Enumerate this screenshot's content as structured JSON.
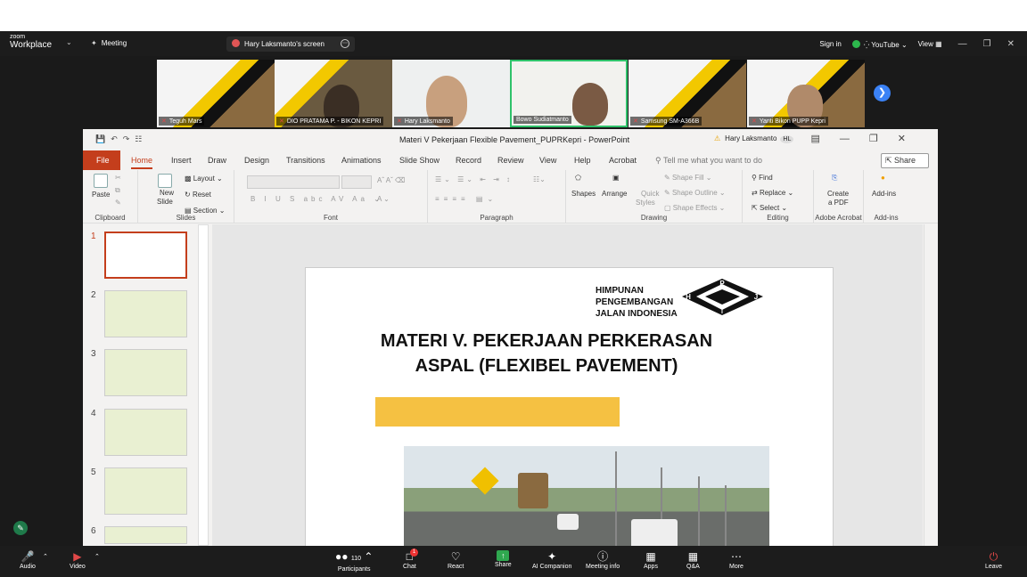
{
  "zoom": {
    "brand_small": "zoom",
    "brand_main": "Workplace",
    "meeting_label": "Meeting",
    "screen_share_label": "Hary Laksmanto's screen",
    "sign_in": "Sign in",
    "youtube": "YouTube",
    "view": "View",
    "participants_count": "110",
    "toolbar": {
      "audio": "Audio",
      "video": "Video",
      "participants": "Participants",
      "chat": "Chat",
      "chat_badge": "1",
      "react": "React",
      "share": "Share",
      "ai": "AI Companion",
      "info": "Meeting info",
      "apps": "Apps",
      "qa": "Q&A",
      "more": "More",
      "leave": "Leave"
    },
    "participants": [
      {
        "name": "Teguh Mars"
      },
      {
        "name": "DIO PRATAMA P. - BIKON KEPRI"
      },
      {
        "name": "Hary Laksmanto"
      },
      {
        "name": "Bowo Sudiatmanto"
      },
      {
        "name": "Samsung SM-A366B"
      },
      {
        "name": "Yanti Bikon PUPP Kepri"
      }
    ]
  },
  "ppt": {
    "title": "Materi V Pekerjaan Flexible Pavement_PUPRKepri  -  PowerPoint",
    "user": "Hary Laksmanto",
    "user_initials": "HL",
    "tabs": [
      "File",
      "Home",
      "Insert",
      "Draw",
      "Design",
      "Transitions",
      "Animations",
      "Slide Show",
      "Record",
      "Review",
      "View",
      "Help",
      "Acrobat"
    ],
    "tell_me": "Tell me what you want to do",
    "share": "Share",
    "ribbon": {
      "paste": "Paste",
      "clipboard": "Clipboard",
      "new_slide_1": "New",
      "new_slide_2": "Slide",
      "layout": "Layout",
      "reset": "Reset",
      "section": "Section",
      "slides": "Slides",
      "font": "Font",
      "paragraph": "Paragraph",
      "shapes": "Shapes",
      "arrange": "Arrange",
      "quick_styles_1": "Quick",
      "quick_styles_2": "Styles",
      "shape_fill": "Shape Fill",
      "shape_outline": "Shape Outline",
      "shape_effects": "Shape Effects",
      "drawing": "Drawing",
      "find": "Find",
      "replace": "Replace",
      "select": "Select",
      "editing": "Editing",
      "create_pdf_1": "Create",
      "create_pdf_2": "a PDF",
      "adobe": "Adobe Acrobat",
      "addins": "Add-ins",
      "addins_grp": "Add-ins"
    },
    "slide_numbers": [
      "1",
      "2",
      "3",
      "4",
      "5",
      "6"
    ],
    "slide": {
      "org_line1": "HIMPUNAN",
      "org_line2": "PENGEMBANGAN",
      "org_line3": "JALAN INDONESIA",
      "title_line1": "MATERI V. PEKERJAAN PERKERASAN",
      "title_line2": "ASPAL (FLEXIBEL PAVEMENT)",
      "logo_letters": [
        "P",
        "H",
        "J",
        "I"
      ]
    }
  }
}
